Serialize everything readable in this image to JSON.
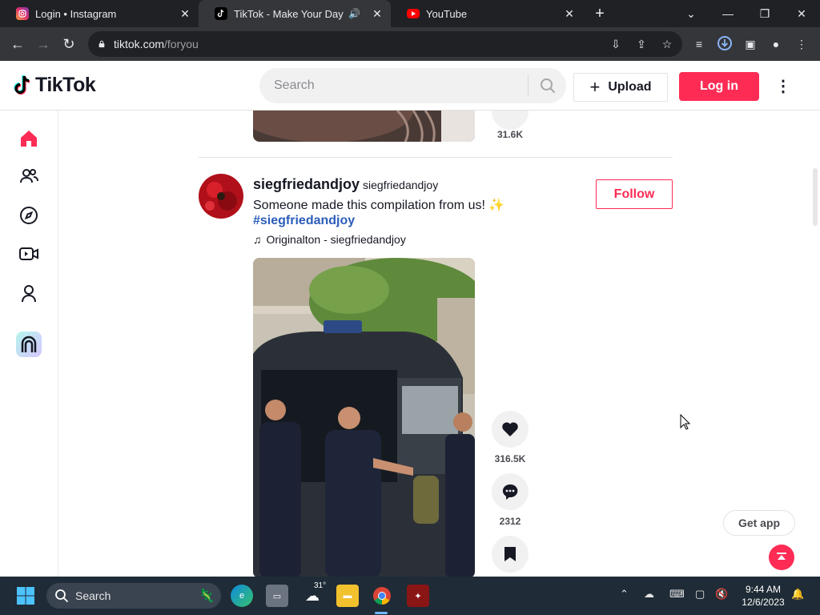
{
  "browser": {
    "tabs": [
      {
        "title": "Login • Instagram",
        "active": false
      },
      {
        "title": "TikTok - Make Your Day",
        "active": true
      },
      {
        "title": "YouTube",
        "active": false
      }
    ],
    "address": {
      "host": "tiktok.com",
      "path": "/foryou"
    }
  },
  "header": {
    "logo_text": "TikTok",
    "search_placeholder": "Search",
    "upload_label": "Upload",
    "login_label": "Log in"
  },
  "sidebar": {
    "items": [
      {
        "name": "home",
        "icon": "home-icon",
        "active": true
      },
      {
        "name": "following",
        "icon": "users-icon"
      },
      {
        "name": "explore",
        "icon": "compass-icon"
      },
      {
        "name": "live",
        "icon": "live-camera-icon"
      },
      {
        "name": "profile",
        "icon": "person-icon"
      },
      {
        "name": "effect-house",
        "icon": "effect-house-icon"
      }
    ]
  },
  "feed": {
    "previous_post": {
      "count": "31.6K"
    },
    "post": {
      "author_name": "siegfriedandjoy",
      "author_nick": "siegfriedandjoy",
      "caption": "Someone made this compilation from us!",
      "caption_emoji": "✨",
      "hashtag": "#siegfriedandjoy",
      "music": "Originalton - siegfriedandjoy",
      "follow_label": "Follow",
      "likes": "316.5K",
      "comments": "2312"
    },
    "get_app_label": "Get app"
  },
  "taskbar": {
    "search_label": "Search",
    "weather_temp": "31°",
    "time": "9:44 AM",
    "date": "12/6/2023"
  },
  "colors": {
    "brand": "#fe2c55",
    "hashtag": "#2b5db9",
    "text": "#161823"
  }
}
